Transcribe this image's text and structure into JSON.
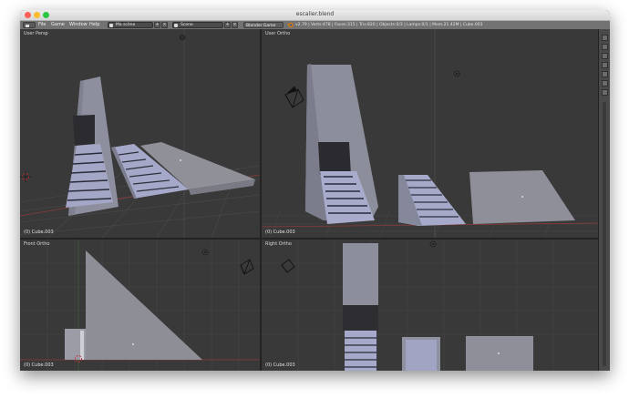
{
  "window": {
    "title": "escalier.blend"
  },
  "menu": {
    "items": [
      "File",
      "Game",
      "Window",
      "Help"
    ]
  },
  "header": {
    "layout_field": "Ma scène",
    "scene_field": "Scene",
    "engine": "Blender Game",
    "stats": "v2.79 | Verts:478 | Faces:315 | Tris:820 | Objects:0/3 | Lamps:0/1 | Mem:21.42M | Cube.003"
  },
  "viewports": {
    "top_left": {
      "label": "User Persp",
      "object": "(0) Cube.003"
    },
    "top_right": {
      "label": "User Ortho",
      "object": "(0) Cube.003"
    },
    "bottom_left": {
      "label": "Front Ortho",
      "object": "(0) Cube.003"
    },
    "bottom_right": {
      "label": "Right Ortho",
      "object": "(0) Cube.003"
    }
  },
  "colors": {
    "viewport_bg": "#393939",
    "mesh": "#8f8f9c",
    "mesh_light": "#b4b6d4",
    "accent": "#e07b00"
  },
  "icons": [
    "blender-logo-icon",
    "camera-icon",
    "lamp-icon",
    "cursor-icon"
  ]
}
